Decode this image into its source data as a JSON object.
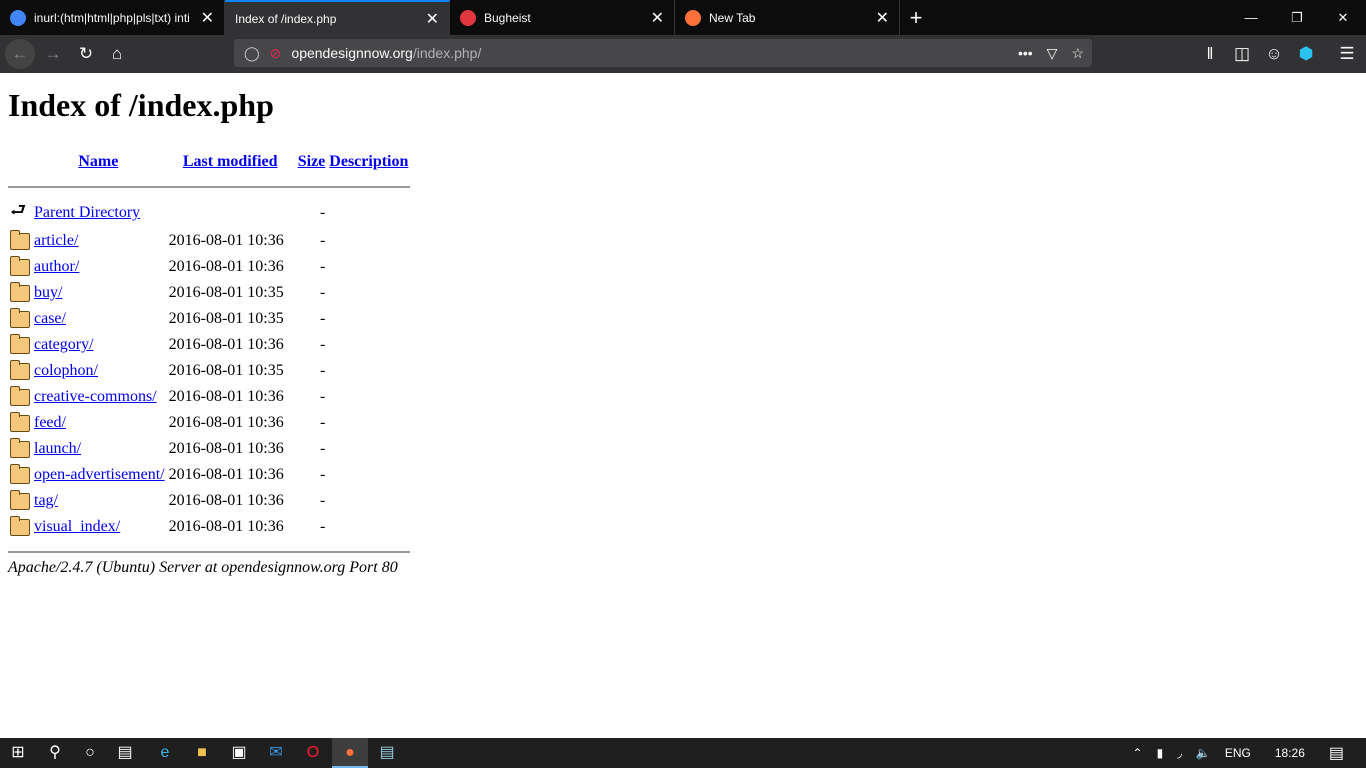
{
  "browser": {
    "tabs": [
      {
        "title": "inurl:(htm|html|php|pls|txt) inti",
        "icon": "google-icon",
        "color": "#4285f4",
        "active": false
      },
      {
        "title": "Index of /index.php",
        "icon": "",
        "active": true
      },
      {
        "title": "Bugheist",
        "icon": "bugheist-icon",
        "color": "#e0383e",
        "active": false
      },
      {
        "title": "New Tab",
        "icon": "firefox-icon",
        "color": "#ff7139",
        "active": false
      }
    ],
    "url_host": "opendesignnow.org",
    "url_path": "/index.php/"
  },
  "page": {
    "title": "Index of /index.php",
    "columns": [
      "Name",
      "Last modified",
      "Size",
      "Description"
    ],
    "parent": {
      "name": "Parent Directory",
      "size": "-"
    },
    "rows": [
      {
        "name": "article/",
        "modified": "2016-08-01 10:36",
        "size": "-"
      },
      {
        "name": "author/",
        "modified": "2016-08-01 10:36",
        "size": "-"
      },
      {
        "name": "buy/",
        "modified": "2016-08-01 10:35",
        "size": "-"
      },
      {
        "name": "case/",
        "modified": "2016-08-01 10:35",
        "size": "-"
      },
      {
        "name": "category/",
        "modified": "2016-08-01 10:36",
        "size": "-"
      },
      {
        "name": "colophon/",
        "modified": "2016-08-01 10:35",
        "size": "-"
      },
      {
        "name": "creative-commons/",
        "modified": "2016-08-01 10:36",
        "size": "-"
      },
      {
        "name": "feed/",
        "modified": "2016-08-01 10:36",
        "size": "-"
      },
      {
        "name": "launch/",
        "modified": "2016-08-01 10:36",
        "size": "-"
      },
      {
        "name": "open-advertisement/",
        "modified": "2016-08-01 10:36",
        "size": "-"
      },
      {
        "name": "tag/",
        "modified": "2016-08-01 10:36",
        "size": "-"
      },
      {
        "name": "visual_index/",
        "modified": "2016-08-01 10:36",
        "size": "-"
      }
    ],
    "footer": "Apache/2.4.7 (Ubuntu) Server at opendesignnow.org Port 80"
  },
  "taskbar": {
    "language": "ENG",
    "time": "18:26"
  }
}
